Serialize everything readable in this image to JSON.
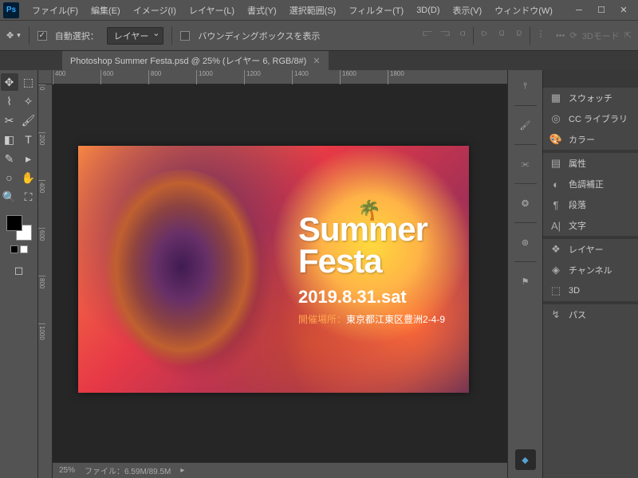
{
  "menubar": {
    "logo": "Ps",
    "items": [
      "ファイル(F)",
      "編集(E)",
      "イメージ(I)",
      "レイヤー(L)",
      "書式(Y)",
      "選択範囲(S)",
      "フィルター(T)",
      "3D(D)",
      "表示(V)",
      "ウィンドウ(W)"
    ]
  },
  "optionsbar": {
    "auto_select_label": "自動選択：",
    "auto_select_value": "レイヤー",
    "bounding_box_label": "バウンディングボックスを表示",
    "mode_3d": "3Dモード"
  },
  "doctab": {
    "title": "Photoshop Summer Festa.psd @ 25% (レイヤー 6, RGB/8#)"
  },
  "ruler_h": [
    "400",
    "600",
    "800",
    "1000",
    "1200",
    "1400",
    "1600",
    "1800"
  ],
  "ruler_v": [
    "0",
    "200",
    "400",
    "600",
    "800",
    "1000"
  ],
  "artwork": {
    "title1": "Summer",
    "title2": "Festa",
    "palm": "🌴",
    "date": "2019.8.31.sat",
    "location_label": "開催場所：",
    "location": "東京都江東区豊洲2-4-9"
  },
  "statusbar": {
    "zoom": "25%",
    "filesize_label": "ファイル：",
    "filesize": "6.59M/89.5M"
  },
  "panels": {
    "group1": [
      "スウォッチ",
      "CC ライブラリ",
      "カラー"
    ],
    "group2": [
      "属性",
      "色調補正",
      "段落",
      "文字"
    ],
    "group3": [
      "レイヤー",
      "チャンネル",
      "3D"
    ],
    "group4": [
      "パス"
    ]
  },
  "panel_icons": {
    "swatches": "▦",
    "cclib": "◎",
    "color": "🎨",
    "props": "▤",
    "adjust": "◐",
    "para": "¶",
    "char": "A|",
    "layers": "❖",
    "channels": "◈",
    "3d": "⬚",
    "paths": "↯"
  }
}
